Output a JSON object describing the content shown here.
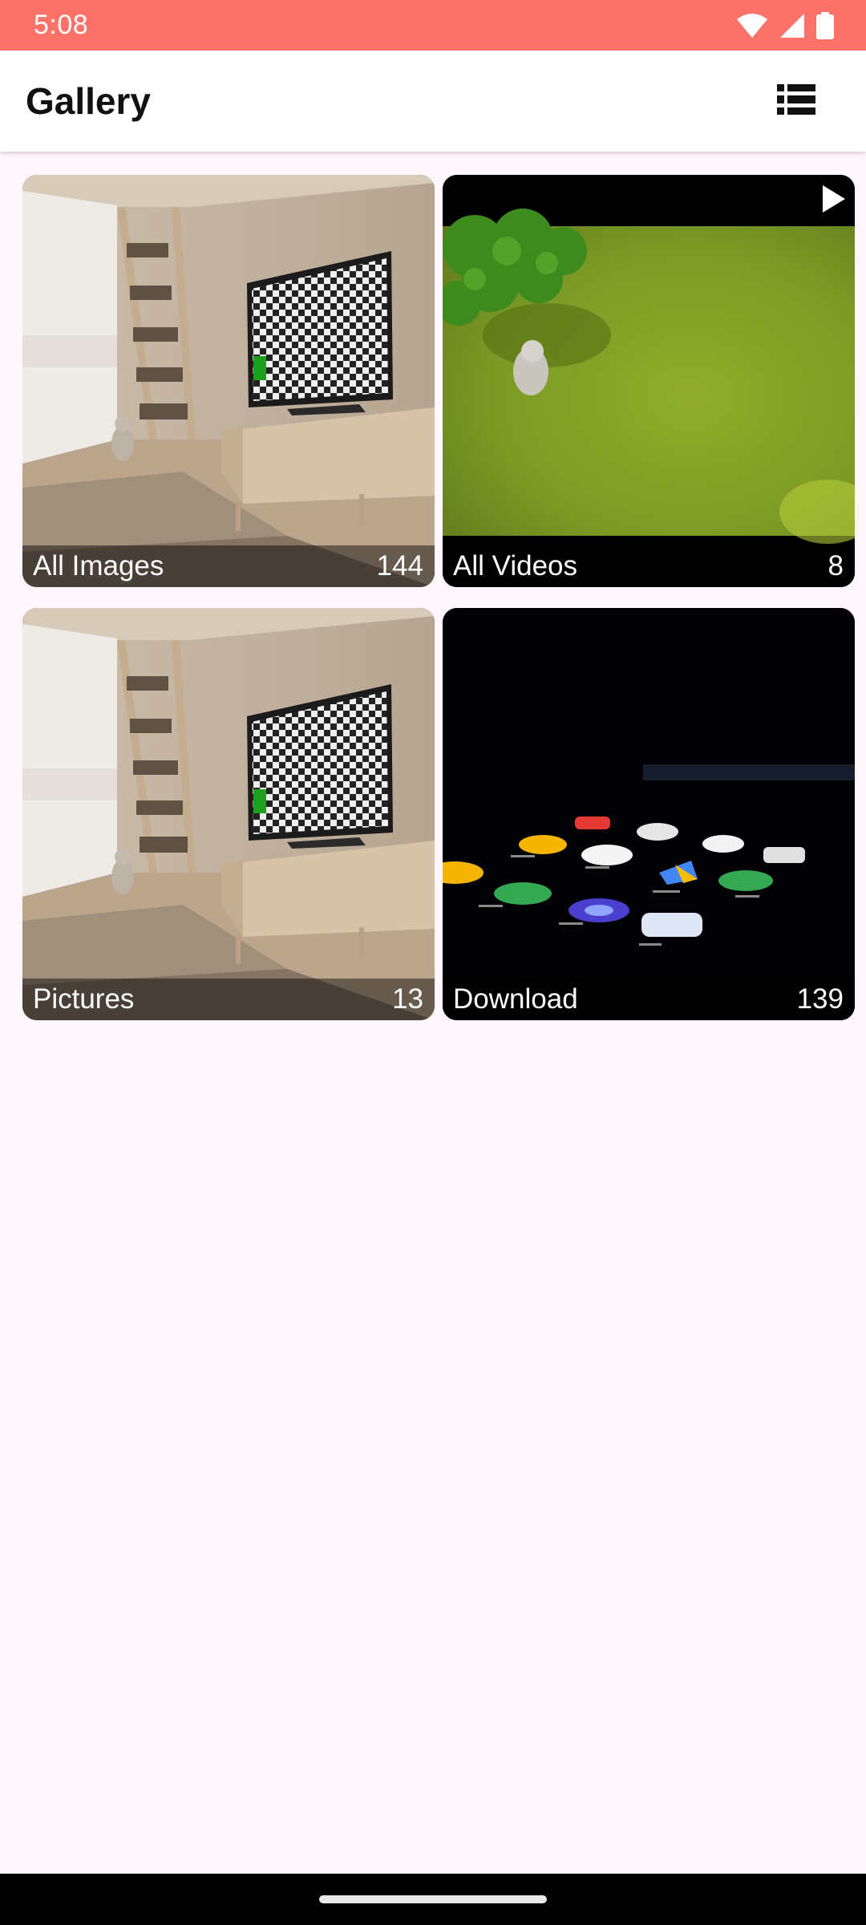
{
  "status_bar": {
    "time": "5:08",
    "icons": [
      "wifi-icon",
      "cellular-signal-icon",
      "battery-icon"
    ]
  },
  "app_bar": {
    "title": "Gallery",
    "view_toggle_icon": "list-view-icon"
  },
  "albums": [
    {
      "name": "All Images",
      "count": "144",
      "thumbnail": "living-room-tv-checkerboard",
      "is_video": false
    },
    {
      "name": "All Videos",
      "count": "8",
      "thumbnail": "grass-field-animal",
      "is_video": true,
      "badge_icon": "play-icon"
    },
    {
      "name": "Pictures",
      "count": "13",
      "thumbnail": "living-room-tv-checkerboard",
      "is_video": false
    },
    {
      "name": "Download",
      "count": "139",
      "thumbnail": "phone-app-icons-dark",
      "is_video": false
    }
  ],
  "colors": {
    "status_bar": "#fa7268",
    "app_bar": "#ffffff",
    "background": "#fdf7fb",
    "nav_bar": "#000000"
  }
}
